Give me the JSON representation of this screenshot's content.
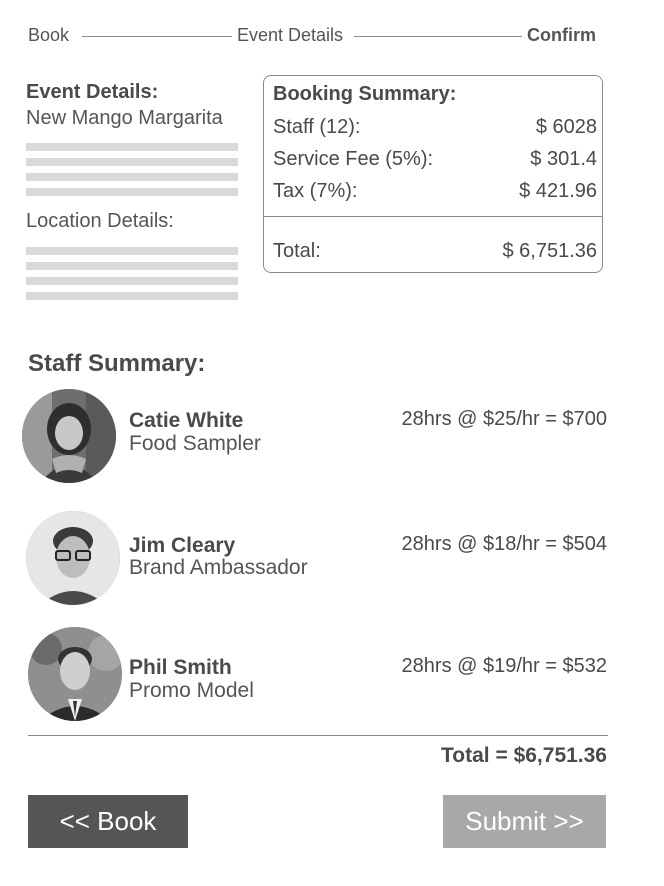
{
  "stepper": {
    "step1": "Book",
    "step2": "Event Details",
    "step3": "Confirm"
  },
  "event": {
    "heading": "Event Details:",
    "name": "New Mango Margarita",
    "location_heading": "Location Details:"
  },
  "booking_summary": {
    "heading": "Booking Summary:",
    "rows": [
      {
        "label": "Staff (12):",
        "value": "$ 6028"
      },
      {
        "label": "Service Fee (5%):",
        "value": "$ 301.4"
      },
      {
        "label": "Tax (7%):",
        "value": "$ 421.96"
      }
    ],
    "total_label": "Total:",
    "total_value": "$ 6,751.36"
  },
  "staff_summary": {
    "heading": "Staff Summary:",
    "members": [
      {
        "name": "Catie White",
        "role": "Food Sampler",
        "rate": "28hrs @ $25/hr =  $700"
      },
      {
        "name": "Jim Cleary",
        "role": "Brand Ambassador",
        "rate": "28hrs @ $18/hr =  $504"
      },
      {
        "name": "Phil Smith",
        "role": "Promo Model",
        "rate": "28hrs @ $19/hr =  $532"
      }
    ],
    "total": "Total  =  $6,751.36"
  },
  "buttons": {
    "back": "<< Book",
    "submit": "Submit  >>"
  }
}
